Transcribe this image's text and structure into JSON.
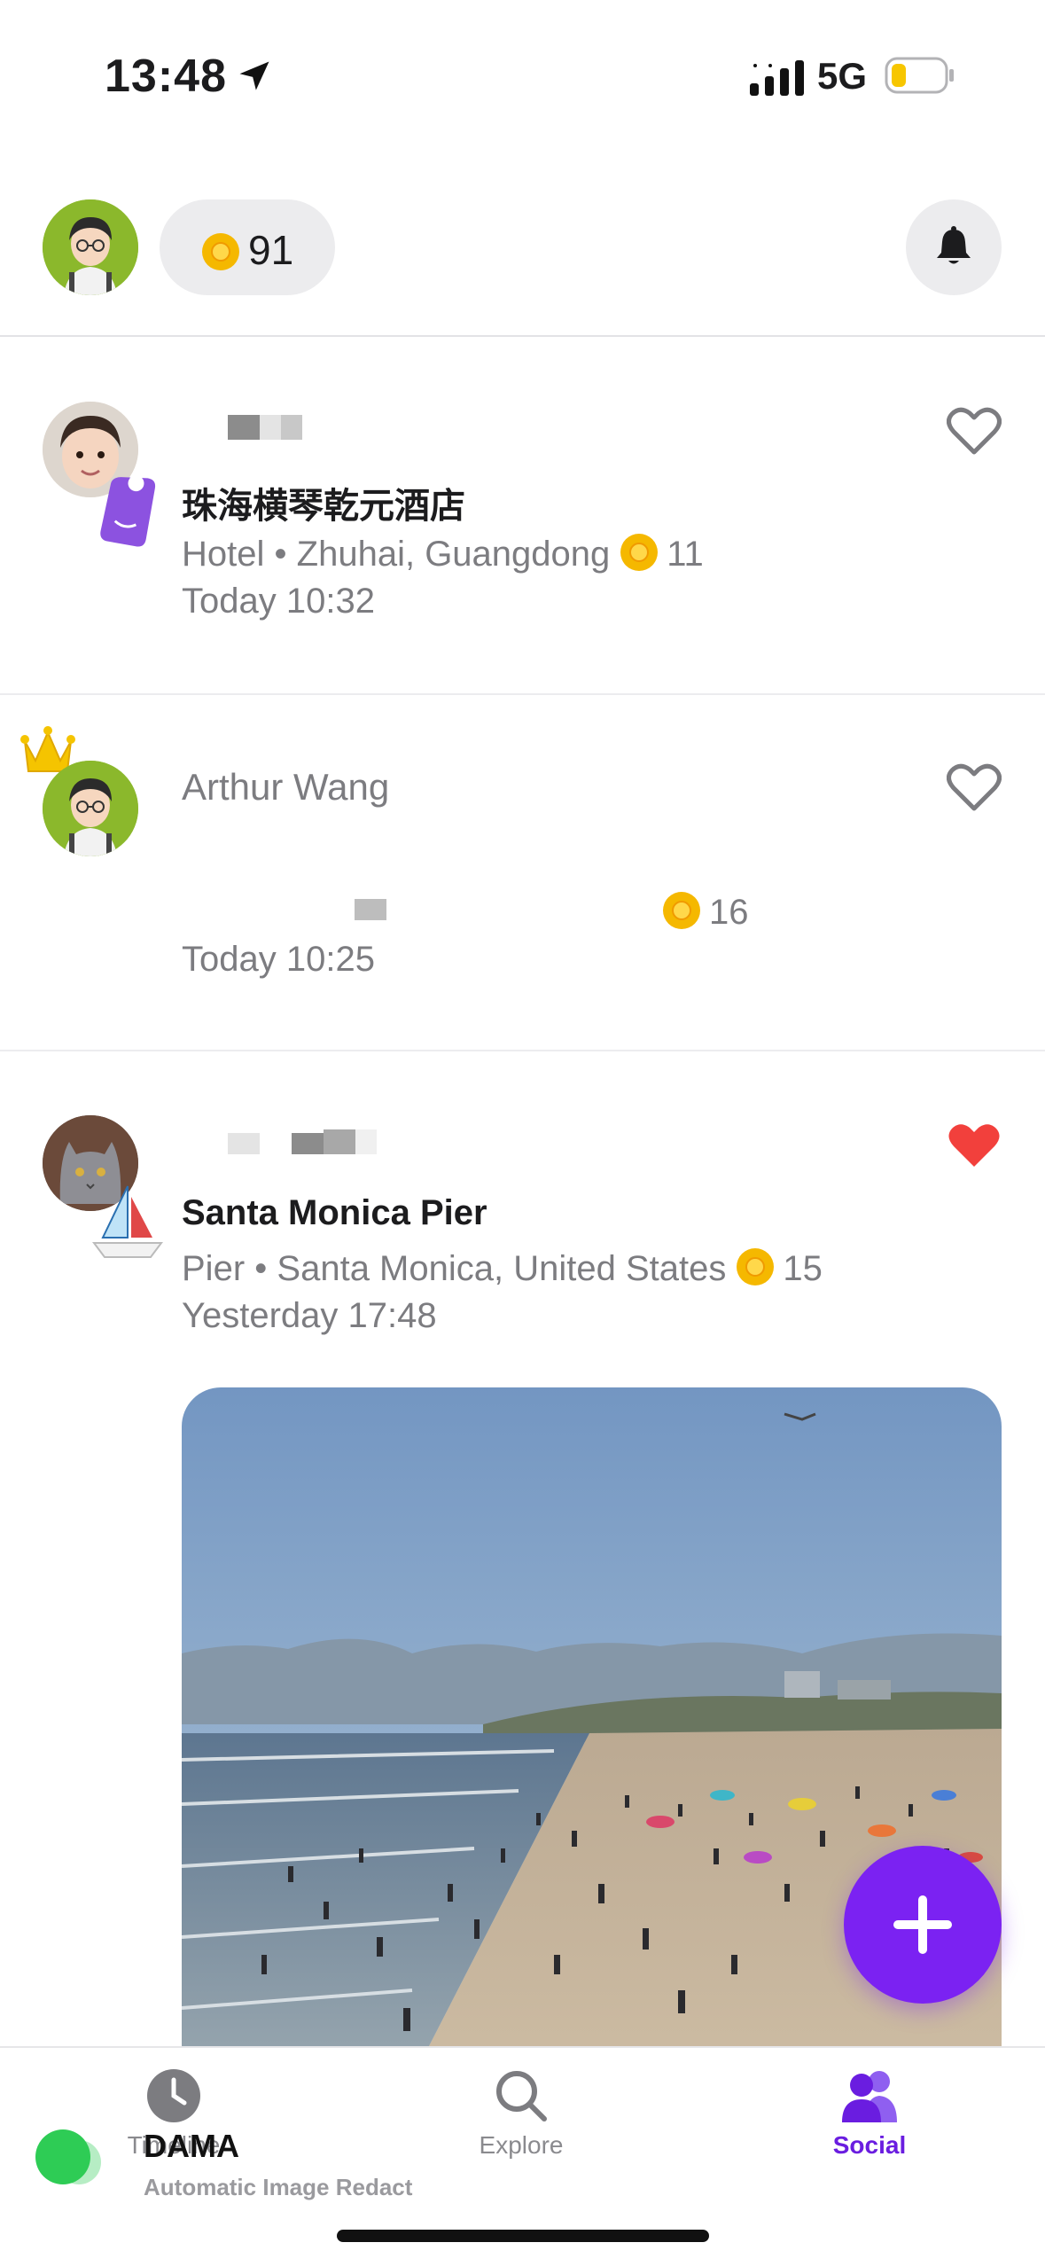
{
  "status_bar": {
    "time": "13:48",
    "network": "5G"
  },
  "header": {
    "coins": "91"
  },
  "feed": [
    {
      "place": "珠海横琴乾元酒店",
      "category": "Hotel",
      "location": "Zhuhai, Guangdong",
      "points": "11",
      "timestamp": "Today 10:32",
      "liked": false
    },
    {
      "user": "Arthur Wang",
      "points": "16",
      "timestamp": "Today 10:25",
      "liked": false
    },
    {
      "place": "Santa Monica Pier",
      "category": "Pier",
      "location": "Santa Monica, United States",
      "points": "15",
      "timestamp": "Yesterday 17:48",
      "liked": true
    }
  ],
  "meta_separator": "•",
  "tabs": [
    {
      "label": "Timeline",
      "icon": "clock-icon"
    },
    {
      "label": "Explore",
      "icon": "search-icon"
    },
    {
      "label": "Social",
      "icon": "people-icon"
    }
  ],
  "watermark": {
    "brand": "DAMA",
    "subtitle": "Automatic Image Redact"
  },
  "colors": {
    "accent": "#7b22f2",
    "liked": "#f2403c",
    "coin": "#f5b800"
  }
}
